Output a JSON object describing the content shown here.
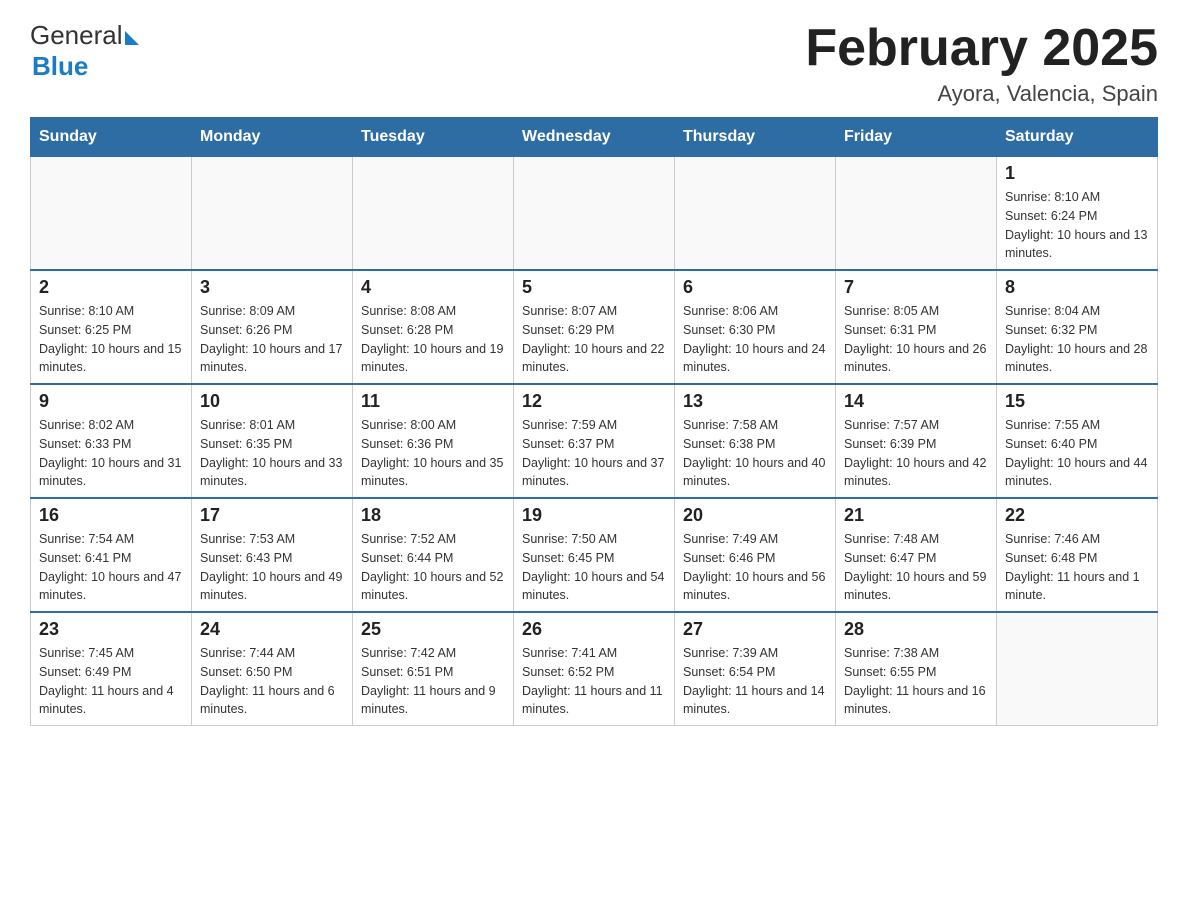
{
  "header": {
    "logo_general": "General",
    "logo_blue": "Blue",
    "month_title": "February 2025",
    "location": "Ayora, Valencia, Spain"
  },
  "days_of_week": [
    "Sunday",
    "Monday",
    "Tuesday",
    "Wednesday",
    "Thursday",
    "Friday",
    "Saturday"
  ],
  "weeks": [
    [
      {
        "day": "",
        "info": ""
      },
      {
        "day": "",
        "info": ""
      },
      {
        "day": "",
        "info": ""
      },
      {
        "day": "",
        "info": ""
      },
      {
        "day": "",
        "info": ""
      },
      {
        "day": "",
        "info": ""
      },
      {
        "day": "1",
        "info": "Sunrise: 8:10 AM\nSunset: 6:24 PM\nDaylight: 10 hours and 13 minutes."
      }
    ],
    [
      {
        "day": "2",
        "info": "Sunrise: 8:10 AM\nSunset: 6:25 PM\nDaylight: 10 hours and 15 minutes."
      },
      {
        "day": "3",
        "info": "Sunrise: 8:09 AM\nSunset: 6:26 PM\nDaylight: 10 hours and 17 minutes."
      },
      {
        "day": "4",
        "info": "Sunrise: 8:08 AM\nSunset: 6:28 PM\nDaylight: 10 hours and 19 minutes."
      },
      {
        "day": "5",
        "info": "Sunrise: 8:07 AM\nSunset: 6:29 PM\nDaylight: 10 hours and 22 minutes."
      },
      {
        "day": "6",
        "info": "Sunrise: 8:06 AM\nSunset: 6:30 PM\nDaylight: 10 hours and 24 minutes."
      },
      {
        "day": "7",
        "info": "Sunrise: 8:05 AM\nSunset: 6:31 PM\nDaylight: 10 hours and 26 minutes."
      },
      {
        "day": "8",
        "info": "Sunrise: 8:04 AM\nSunset: 6:32 PM\nDaylight: 10 hours and 28 minutes."
      }
    ],
    [
      {
        "day": "9",
        "info": "Sunrise: 8:02 AM\nSunset: 6:33 PM\nDaylight: 10 hours and 31 minutes."
      },
      {
        "day": "10",
        "info": "Sunrise: 8:01 AM\nSunset: 6:35 PM\nDaylight: 10 hours and 33 minutes."
      },
      {
        "day": "11",
        "info": "Sunrise: 8:00 AM\nSunset: 6:36 PM\nDaylight: 10 hours and 35 minutes."
      },
      {
        "day": "12",
        "info": "Sunrise: 7:59 AM\nSunset: 6:37 PM\nDaylight: 10 hours and 37 minutes."
      },
      {
        "day": "13",
        "info": "Sunrise: 7:58 AM\nSunset: 6:38 PM\nDaylight: 10 hours and 40 minutes."
      },
      {
        "day": "14",
        "info": "Sunrise: 7:57 AM\nSunset: 6:39 PM\nDaylight: 10 hours and 42 minutes."
      },
      {
        "day": "15",
        "info": "Sunrise: 7:55 AM\nSunset: 6:40 PM\nDaylight: 10 hours and 44 minutes."
      }
    ],
    [
      {
        "day": "16",
        "info": "Sunrise: 7:54 AM\nSunset: 6:41 PM\nDaylight: 10 hours and 47 minutes."
      },
      {
        "day": "17",
        "info": "Sunrise: 7:53 AM\nSunset: 6:43 PM\nDaylight: 10 hours and 49 minutes."
      },
      {
        "day": "18",
        "info": "Sunrise: 7:52 AM\nSunset: 6:44 PM\nDaylight: 10 hours and 52 minutes."
      },
      {
        "day": "19",
        "info": "Sunrise: 7:50 AM\nSunset: 6:45 PM\nDaylight: 10 hours and 54 minutes."
      },
      {
        "day": "20",
        "info": "Sunrise: 7:49 AM\nSunset: 6:46 PM\nDaylight: 10 hours and 56 minutes."
      },
      {
        "day": "21",
        "info": "Sunrise: 7:48 AM\nSunset: 6:47 PM\nDaylight: 10 hours and 59 minutes."
      },
      {
        "day": "22",
        "info": "Sunrise: 7:46 AM\nSunset: 6:48 PM\nDaylight: 11 hours and 1 minute."
      }
    ],
    [
      {
        "day": "23",
        "info": "Sunrise: 7:45 AM\nSunset: 6:49 PM\nDaylight: 11 hours and 4 minutes."
      },
      {
        "day": "24",
        "info": "Sunrise: 7:44 AM\nSunset: 6:50 PM\nDaylight: 11 hours and 6 minutes."
      },
      {
        "day": "25",
        "info": "Sunrise: 7:42 AM\nSunset: 6:51 PM\nDaylight: 11 hours and 9 minutes."
      },
      {
        "day": "26",
        "info": "Sunrise: 7:41 AM\nSunset: 6:52 PM\nDaylight: 11 hours and 11 minutes."
      },
      {
        "day": "27",
        "info": "Sunrise: 7:39 AM\nSunset: 6:54 PM\nDaylight: 11 hours and 14 minutes."
      },
      {
        "day": "28",
        "info": "Sunrise: 7:38 AM\nSunset: 6:55 PM\nDaylight: 11 hours and 16 minutes."
      },
      {
        "day": "",
        "info": ""
      }
    ]
  ]
}
